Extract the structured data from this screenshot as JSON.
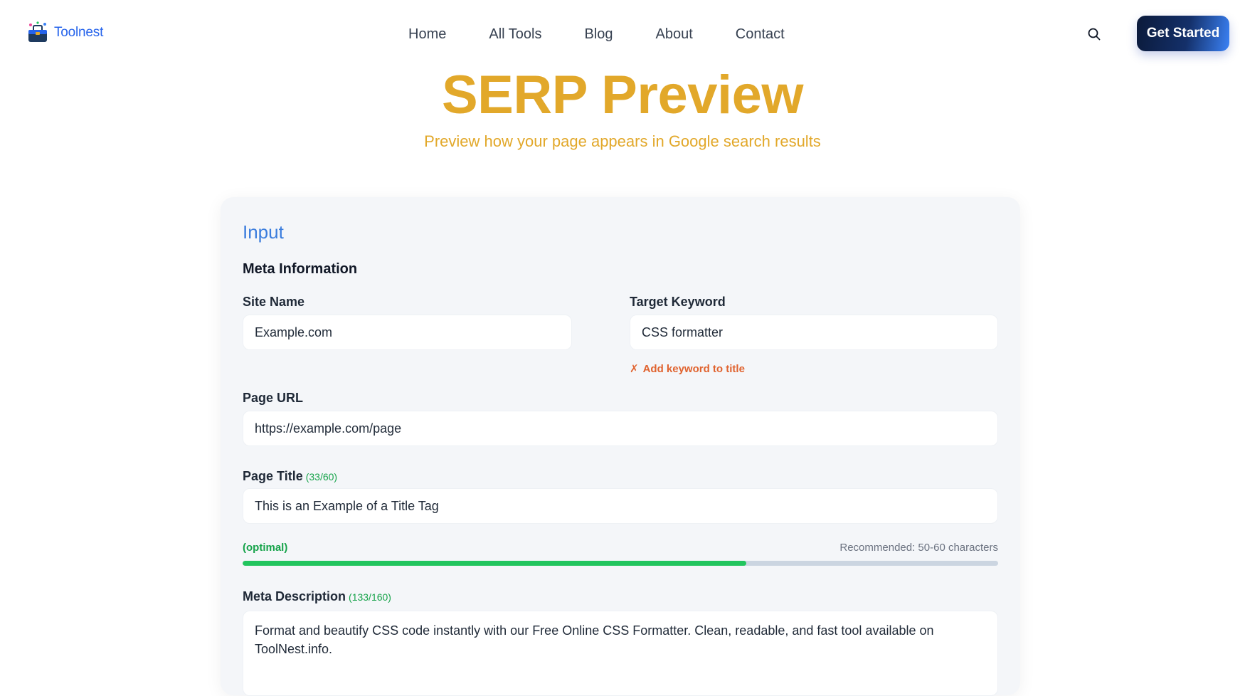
{
  "brand": {
    "name": "Toolnest"
  },
  "nav": {
    "items": [
      "Home",
      "All Tools",
      "Blog",
      "About",
      "Contact"
    ],
    "cta_label": "Get Started"
  },
  "hero": {
    "title": "SERP Preview",
    "subtitle": "Preview how your page appears in Google search results"
  },
  "input_card": {
    "title": "Input",
    "section": "Meta Information",
    "site_name": {
      "label": "Site Name",
      "value": "Example.com"
    },
    "target_keyword": {
      "label": "Target Keyword",
      "value": "CSS formatter",
      "warning_icon": "✗",
      "warning": "Add keyword to title"
    },
    "page_url": {
      "label": "Page URL",
      "value": "https://example.com/page"
    },
    "page_title": {
      "label": "Page Title",
      "count": "(33/60)",
      "value": "This is an Example of a Title Tag",
      "status": "(optimal)",
      "recommended": "Recommended: 50-60 characters",
      "progress_fraction": 0.667
    },
    "meta_description": {
      "label": "Meta Description",
      "count": "(133/160)",
      "value": "Format and beautify CSS code instantly with our Free Online CSS Formatter. Clean, readable, and fast tool available on ToolNest.info."
    }
  },
  "colors": {
    "accent_gold": "#e2a82a",
    "accent_blue": "#3b7ddd",
    "success": "#16a34a",
    "warning": "#e0632f"
  }
}
